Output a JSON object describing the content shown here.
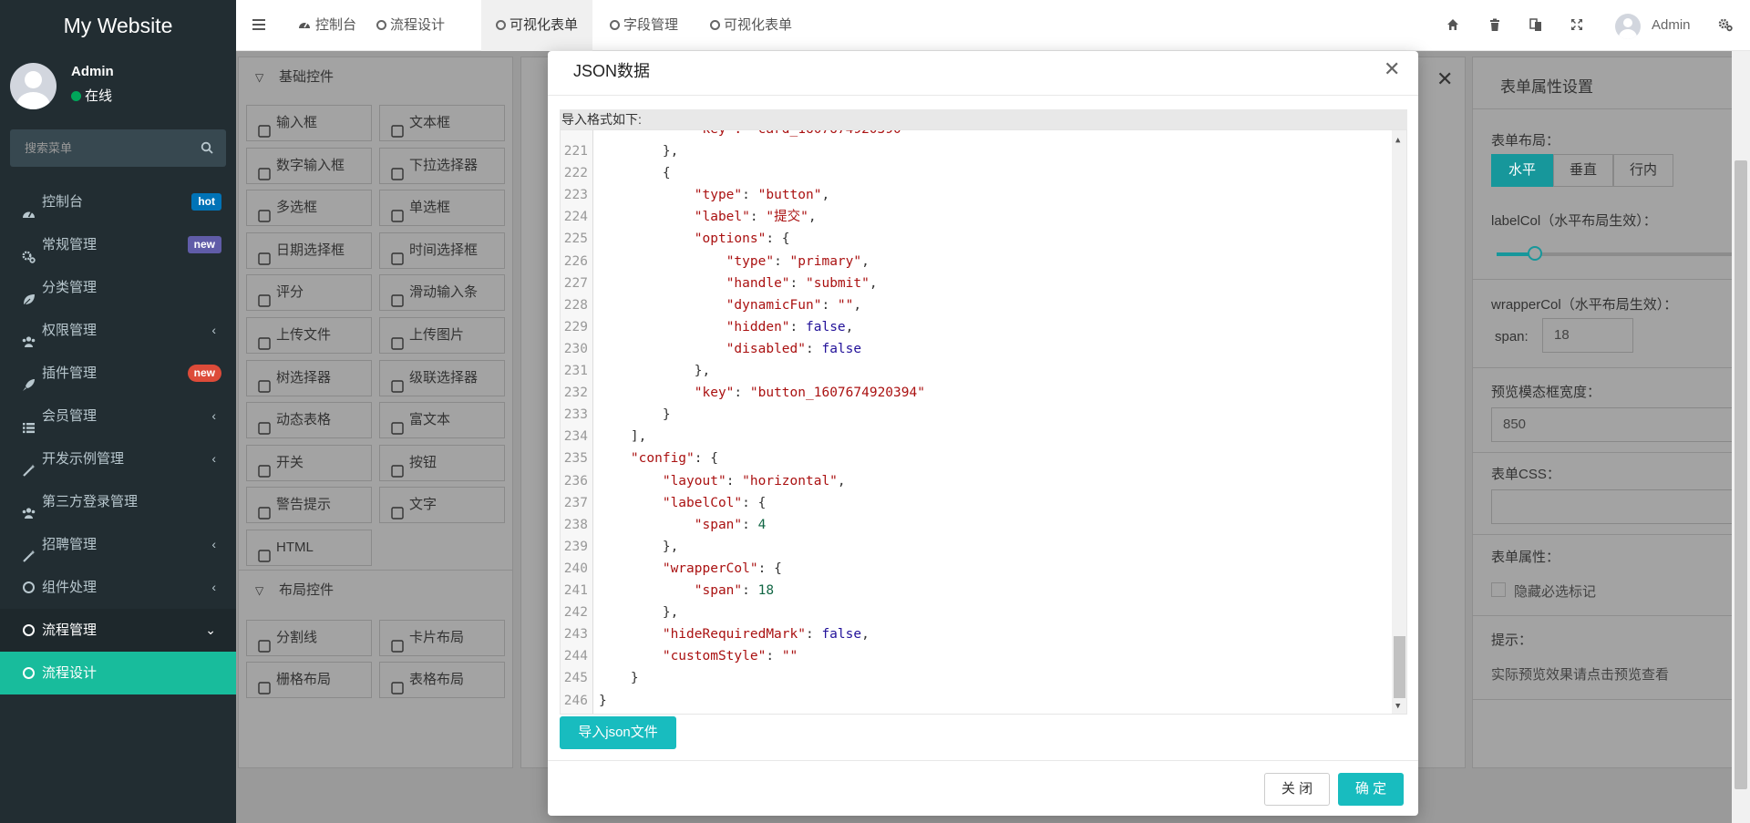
{
  "sidebar": {
    "logo": "My Website",
    "user_name": "Admin",
    "user_status": "在线",
    "search_placeholder": "搜索菜单",
    "items": [
      {
        "label": "控制台",
        "icon": "dashboard-icon",
        "badge": "hot"
      },
      {
        "label": "常规管理",
        "icon": "cogs-icon",
        "badge": "new"
      },
      {
        "label": "分类管理",
        "icon": "leaf-icon"
      },
      {
        "label": "权限管理",
        "icon": "group-icon",
        "chevron": "‹"
      },
      {
        "label": "插件管理",
        "icon": "rocket-icon",
        "badge": "new"
      },
      {
        "label": "会员管理",
        "icon": "list-icon",
        "chevron": "‹"
      },
      {
        "label": "开发示例管理",
        "icon": "magic-icon",
        "chevron": "‹"
      },
      {
        "label": "第三方登录管理",
        "icon": "group-icon"
      },
      {
        "label": "招聘管理",
        "icon": "magic-icon",
        "chevron": "‹"
      },
      {
        "label": "组件处理",
        "icon": "circle-icon",
        "chevron": "‹"
      },
      {
        "label": "流程管理",
        "icon": "circle-icon",
        "chevron": "⌄"
      },
      {
        "label": "流程设计",
        "icon": "circle-icon"
      }
    ]
  },
  "topbar": {
    "tabs": [
      {
        "label": "控制台"
      },
      {
        "label": "流程设计"
      },
      {
        "label": "可视化表单"
      },
      {
        "label": "字段管理"
      },
      {
        "label": "可视化表单"
      }
    ],
    "admin": "Admin"
  },
  "left_panel": {
    "basic_title": "基础控件",
    "basic_controls": [
      "输入框",
      "文本框",
      "数字输入框",
      "下拉选择器",
      "多选框",
      "单选框",
      "日期选择框",
      "时间选择框",
      "评分",
      "滑动输入条",
      "上传文件",
      "上传图片",
      "树选择器",
      "级联选择器",
      "动态表格",
      "富文本",
      "开关",
      "按钮",
      "警告提示",
      "文字",
      "HTML"
    ],
    "layout_title": "布局控件",
    "layout_controls": [
      "分割线",
      "卡片布局",
      "栅格布局",
      "表格布局"
    ]
  },
  "right_panel": {
    "title": "表单属性设置",
    "layout_label": "表单布局：",
    "layout_options": [
      "水平",
      "垂直",
      "行内"
    ],
    "label_col": "labelCol（水平布局生效）：",
    "label_col_value": 0.25,
    "wrapper_col": "wrapperCol（水平布局生效）：",
    "span_label": "span:",
    "span_value": "18",
    "preview_width_label": "预览模态框宽度：",
    "preview_width_value": "850",
    "css_label": "表单CSS：",
    "attr_label": "表单属性：",
    "hide_required": "隐藏必选标记",
    "tip_label": "提示：",
    "tip_text": "实际预览效果请点击预览查看"
  },
  "modal": {
    "title": "JSON数据",
    "import_hint": "导入格式如下:",
    "import_button": "导入json文件",
    "close_button": "关 闭",
    "ok_button": "确 定",
    "lines": [
      {
        "n": "221",
        "t": "        },"
      },
      {
        "n": "222",
        "t": "        {"
      },
      {
        "n": "223",
        "t": "            \"type\": \"button\","
      },
      {
        "n": "224",
        "t": "            \"label\": \"提交\","
      },
      {
        "n": "225",
        "t": "            \"options\": {"
      },
      {
        "n": "226",
        "t": "                \"type\": \"primary\","
      },
      {
        "n": "227",
        "t": "                \"handle\": \"submit\","
      },
      {
        "n": "228",
        "t": "                \"dynamicFun\": \"\","
      },
      {
        "n": "229",
        "t": "                \"hidden\": false,"
      },
      {
        "n": "230",
        "t": "                \"disabled\": false"
      },
      {
        "n": "231",
        "t": "            },"
      },
      {
        "n": "232",
        "t": "            \"key\": \"button_1607674920394\""
      },
      {
        "n": "233",
        "t": "        }"
      },
      {
        "n": "234",
        "t": "    ],"
      },
      {
        "n": "235",
        "t": "    \"config\": {"
      },
      {
        "n": "236",
        "t": "        \"layout\": \"horizontal\","
      },
      {
        "n": "237",
        "t": "        \"labelCol\": {"
      },
      {
        "n": "238",
        "t": "            \"span\": 4"
      },
      {
        "n": "239",
        "t": "        },"
      },
      {
        "n": "240",
        "t": "        \"wrapperCol\": {"
      },
      {
        "n": "241",
        "t": "            \"span\": 18"
      },
      {
        "n": "242",
        "t": "        },"
      },
      {
        "n": "243",
        "t": "        \"hideRequiredMark\": false,"
      },
      {
        "n": "244",
        "t": "        \"customStyle\": \"\""
      },
      {
        "n": "245",
        "t": "    }"
      },
      {
        "n": "246",
        "t": "}"
      }
    ]
  }
}
